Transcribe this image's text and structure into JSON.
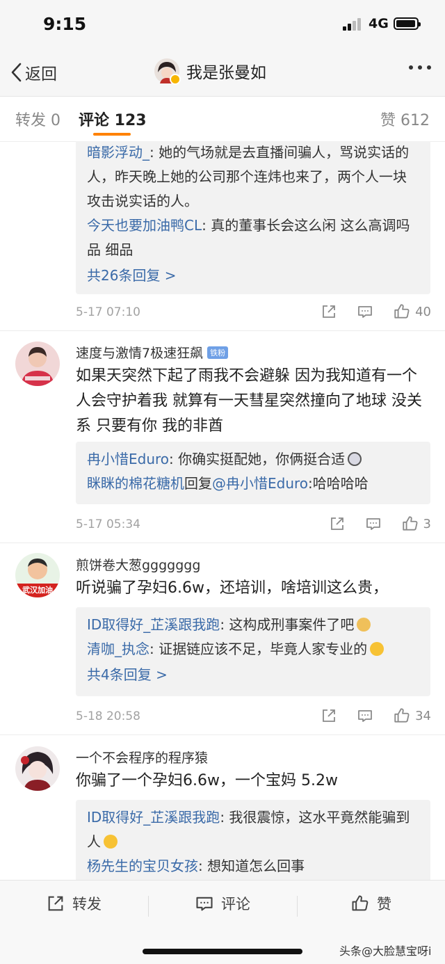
{
  "status_bar": {
    "time": "9:15",
    "network": "4G"
  },
  "navbar": {
    "back_label": "返回",
    "title": "我是张曼如"
  },
  "tabs": {
    "repost": "转发 0",
    "comment": "评论 123",
    "like": "赞 612"
  },
  "comments": [
    {
      "replies": [
        {
          "name": "暗影浮动_",
          "text": ": 她的气场就是去直播间骗人，骂说实话的人，昨天晚上她的公司那个连炜也来了，两个人一块攻击说实话的人。"
        },
        {
          "name": "今天也要加油鸭CL",
          "text": ": 真的董事长会这么闲 这么高调吗 品 细品"
        }
      ],
      "more_replies": "共26条回复 >",
      "time": "5-17 07:10",
      "likes": "40"
    },
    {
      "username": "速度与激情7极速狂飙",
      "badge": "铁粉",
      "text": "如果天突然下起了雨我不会避躲 因为我知道有一个人会守护着我 就算有一天彗星突然撞向了地球 没关系 只要有你 我的非酋",
      "replies": [
        {
          "name": "冉小惜Eduro",
          "text": ": 你确实挺配她，你俩挺合适"
        },
        {
          "name": "眯眯的棉花糖机",
          "text": "回复",
          "name2": "@冉小惜Eduro",
          "text2": ":哈哈哈哈"
        }
      ],
      "time": "5-17 05:34",
      "likes": "3"
    },
    {
      "username": "煎饼卷大葱ggggggg",
      "avatar_text": "武汉加油",
      "text": "听说骗了孕妇6.6w，还培训，啥培训这么贵，",
      "replies": [
        {
          "name": "ID取得好_芷溪跟我跑",
          "text": ": 这构成刑事案件了吧"
        },
        {
          "name": "清咖_执念",
          "text": ": 证据链应该不足，毕竟人家专业的"
        }
      ],
      "more_replies": "共4条回复 >",
      "time": "5-18 20:58",
      "likes": "34"
    },
    {
      "username": "一个不会程序的程序猿",
      "text": "你骗了一个孕妇6.6w，一个宝妈 5.2w",
      "replies": [
        {
          "name": "ID取得好_芷溪跟我跑",
          "text": ": 我很震惊，这水平竟然能骗到人"
        },
        {
          "name": "杨先生的宝贝女孩",
          "text": ": 想知道怎么回事"
        }
      ]
    }
  ],
  "bottom_bar": {
    "repost": "转发",
    "comment": "评论",
    "like": "赞"
  },
  "watermark": "头条@大脸慧宝呀i",
  "colors": {
    "accent": "#ff8200",
    "link": "#3a6aa8"
  }
}
